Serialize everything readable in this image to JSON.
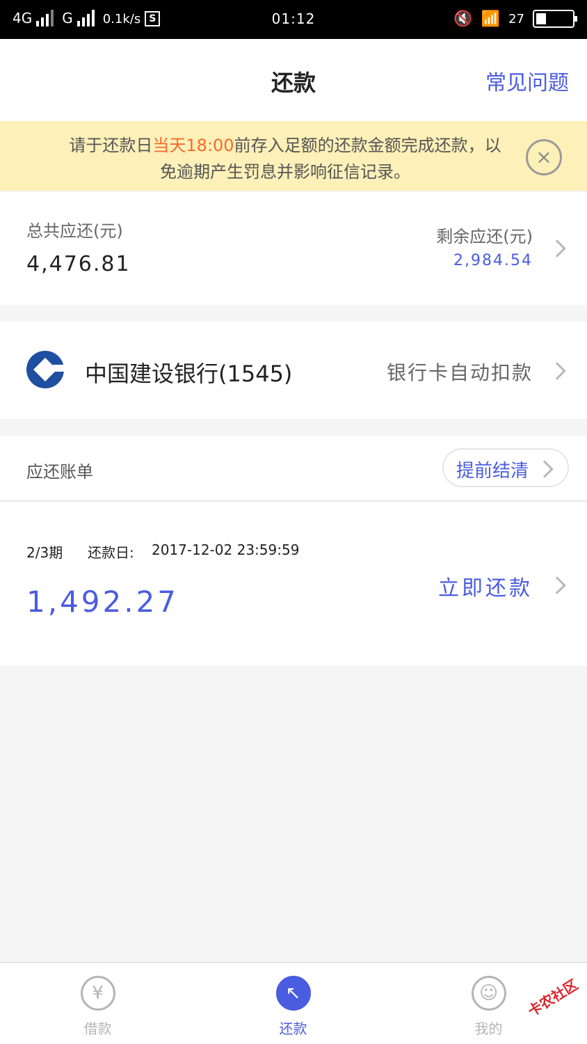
{
  "status_bar": {
    "network_1": "4G",
    "network_2": "G",
    "speed": "0.1k/s",
    "s_badge": "S",
    "time": "01:12",
    "battery": "27",
    "battery_level": 0.27
  },
  "header": {
    "title": "还款",
    "faq_label": "常见问题"
  },
  "notice": {
    "text_before": "请于还款日",
    "text_highlight": "当天18:00",
    "text_after": "前存入足额的还款金额完成还款，以免逾期产生罚息并影响征信记录。",
    "close_symbol": "×"
  },
  "summary": {
    "total_label": "总共应还(元)",
    "total_value": "4,476.81",
    "remaining_label": "剩余应还(元)",
    "remaining_value": "2,984.54"
  },
  "bank": {
    "name": "中国建设银行(1545)",
    "debit_label": "银行卡自动扣款"
  },
  "bills": {
    "title": "应还账单",
    "prepay_label": "提前结清",
    "items": [
      {
        "period": "2/3期",
        "due_label": "还款日:",
        "due_date": "2017-12-02 23:59:59",
        "amount": "1,492.27",
        "action": "立即还款"
      }
    ]
  },
  "tabs": [
    {
      "label": "借款",
      "icon": "yen-icon",
      "glyph": "¥"
    },
    {
      "label": "还款",
      "icon": "repay-arrow-icon",
      "glyph": "↖"
    },
    {
      "label": "我的",
      "icon": "user-icon",
      "glyph": "☺"
    }
  ],
  "watermark": "卡农社区",
  "colors": {
    "accent": "#4a5ce0",
    "highlight": "#f56a2e",
    "notice_bg": "#fdf0b8",
    "bank_logo": "#1f4fa1"
  }
}
